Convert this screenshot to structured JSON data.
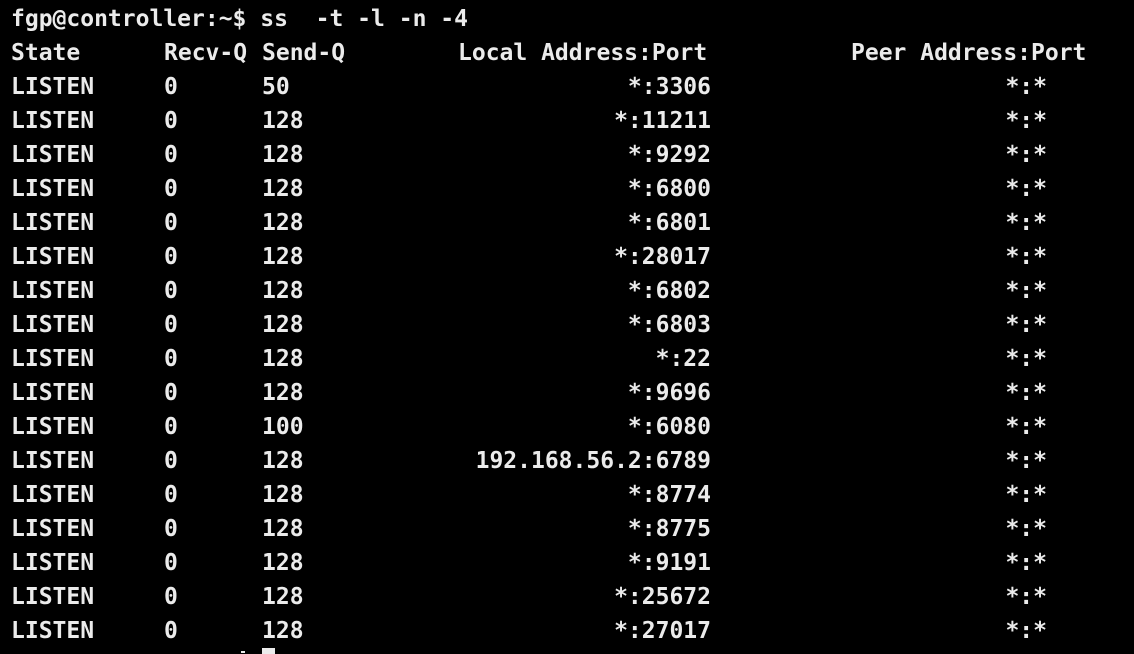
{
  "terminal": {
    "background": "#000000",
    "foreground": "#ebebeb",
    "prompt": "fgp@controller:~$ ss  -t -l -n -4",
    "header": {
      "state": "State",
      "recv_q": "Recv-Q",
      "send_q": "Send-Q",
      "local": "Local Address:Port",
      "peer": "Peer Address:Port"
    },
    "rows": [
      {
        "state": "LISTEN",
        "recv_q": "0",
        "send_q": "50",
        "local": "*:3306",
        "peer": "*:*"
      },
      {
        "state": "LISTEN",
        "recv_q": "0",
        "send_q": "128",
        "local": "*:11211",
        "peer": "*:*"
      },
      {
        "state": "LISTEN",
        "recv_q": "0",
        "send_q": "128",
        "local": "*:9292",
        "peer": "*:*"
      },
      {
        "state": "LISTEN",
        "recv_q": "0",
        "send_q": "128",
        "local": "*:6800",
        "peer": "*:*"
      },
      {
        "state": "LISTEN",
        "recv_q": "0",
        "send_q": "128",
        "local": "*:6801",
        "peer": "*:*"
      },
      {
        "state": "LISTEN",
        "recv_q": "0",
        "send_q": "128",
        "local": "*:28017",
        "peer": "*:*"
      },
      {
        "state": "LISTEN",
        "recv_q": "0",
        "send_q": "128",
        "local": "*:6802",
        "peer": "*:*"
      },
      {
        "state": "LISTEN",
        "recv_q": "0",
        "send_q": "128",
        "local": "*:6803",
        "peer": "*:*"
      },
      {
        "state": "LISTEN",
        "recv_q": "0",
        "send_q": "128",
        "local": "*:22",
        "peer": "*:*"
      },
      {
        "state": "LISTEN",
        "recv_q": "0",
        "send_q": "128",
        "local": "*:9696",
        "peer": "*:*"
      },
      {
        "state": "LISTEN",
        "recv_q": "0",
        "send_q": "100",
        "local": "*:6080",
        "peer": "*:*"
      },
      {
        "state": "LISTEN",
        "recv_q": "0",
        "send_q": "128",
        "local": "192.168.56.2:6789",
        "peer": "*:*"
      },
      {
        "state": "LISTEN",
        "recv_q": "0",
        "send_q": "128",
        "local": "*:8774",
        "peer": "*:*"
      },
      {
        "state": "LISTEN",
        "recv_q": "0",
        "send_q": "128",
        "local": "*:8775",
        "peer": "*:*"
      },
      {
        "state": "LISTEN",
        "recv_q": "0",
        "send_q": "128",
        "local": "*:9191",
        "peer": "*:*"
      },
      {
        "state": "LISTEN",
        "recv_q": "0",
        "send_q": "128",
        "local": "*:25672",
        "peer": "*:*"
      },
      {
        "state": "LISTEN",
        "recv_q": "0",
        "send_q": "128",
        "local": "*:27017",
        "peer": "*:*"
      }
    ]
  }
}
